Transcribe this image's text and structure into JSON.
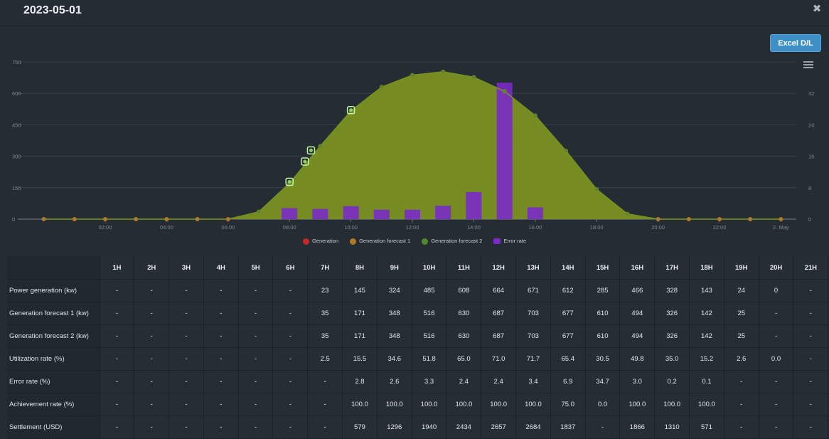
{
  "window": {
    "title": "2023-05-01",
    "close_icon": "close-icon",
    "excel_label": "Excel D/L",
    "menu_icon": "hamburger-menu-icon"
  },
  "colors": {
    "background": "#262c34",
    "forecast_area": "#7d9521",
    "forecast2_line": "#5b8a2c",
    "generation": "#c62828",
    "forecast1": "#b07a2a",
    "forecast2": "#4f8a2b",
    "error_bar": "#7b2ac8",
    "button": "#3d8fc6"
  },
  "chart_data": {
    "type": "area",
    "x_tick_labels": [
      "02:00",
      "04:00",
      "06:00",
      "08:00",
      "10:00",
      "12:00",
      "14:00",
      "16:00",
      "18:00",
      "20:00",
      "22:00",
      "2. May"
    ],
    "x_range_hours": [
      -0.5,
      24.5
    ],
    "y_left_ticks": [
      "0",
      "150",
      "300",
      "450",
      "600",
      "750"
    ],
    "y_left_range": [
      0,
      750
    ],
    "y_right_ticks": [
      "0",
      "8",
      "16",
      "24",
      "32"
    ],
    "y_right_range": [
      0,
      40
    ],
    "grid": true,
    "legend_position": "bottom-center",
    "series": [
      {
        "name": "Generation",
        "kind": "line",
        "axis": "left",
        "x": [
          8,
          8.5,
          8.7,
          10
        ],
        "values": [
          178,
          275,
          328,
          520
        ]
      },
      {
        "name": "Generation forecast 1",
        "kind": "line",
        "axis": "left",
        "x": [
          0,
          1,
          2,
          3,
          4,
          5,
          6,
          7,
          8,
          9,
          10,
          11,
          12,
          13,
          14,
          15,
          16,
          17,
          18,
          19,
          20,
          21,
          22,
          23,
          24
        ],
        "values": [
          0,
          0,
          0,
          0,
          0,
          0,
          0,
          35,
          171,
          348,
          516,
          630,
          687,
          703,
          677,
          610,
          494,
          326,
          142,
          25,
          0,
          0,
          0,
          0,
          0
        ]
      },
      {
        "name": "Generation forecast 2",
        "kind": "area",
        "axis": "left",
        "x": [
          0,
          1,
          2,
          3,
          4,
          5,
          6,
          7,
          8,
          9,
          10,
          11,
          12,
          13,
          14,
          15,
          16,
          17,
          18,
          19,
          20,
          21,
          22,
          23,
          24
        ],
        "values": [
          0,
          0,
          0,
          0,
          0,
          0,
          0,
          35,
          171,
          348,
          516,
          630,
          687,
          703,
          677,
          610,
          494,
          326,
          142,
          25,
          0,
          0,
          0,
          0,
          0
        ]
      },
      {
        "name": "Error rate",
        "kind": "bar",
        "axis": "right",
        "x": [
          8,
          9,
          10,
          11,
          12,
          13,
          14,
          15,
          16
        ],
        "values": [
          2.8,
          2.6,
          3.3,
          2.4,
          2.4,
          3.4,
          6.9,
          34.7,
          3.0
        ]
      }
    ]
  },
  "legend": [
    {
      "label": "Generation",
      "color": "#c62828",
      "shape": "dot"
    },
    {
      "label": "Generation forecast 1",
      "color": "#b07a2a",
      "shape": "dot"
    },
    {
      "label": "Generation forecast 2",
      "color": "#4f8a2b",
      "shape": "dot"
    },
    {
      "label": "Error rate",
      "color": "#7b2ac8",
      "shape": "square"
    }
  ],
  "table": {
    "columns": [
      "",
      "1H",
      "2H",
      "3H",
      "4H",
      "5H",
      "6H",
      "7H",
      "8H",
      "9H",
      "10H",
      "11H",
      "12H",
      "13H",
      "14H",
      "15H",
      "16H",
      "17H",
      "18H",
      "19H",
      "20H",
      "21H"
    ],
    "rows": [
      {
        "label": "Power generation (kw)",
        "cells": [
          "-",
          "-",
          "-",
          "-",
          "-",
          "-",
          "23",
          "145",
          "324",
          "485",
          "608",
          "664",
          "671",
          "612",
          "285",
          "466",
          "328",
          "143",
          "24",
          "0",
          "-"
        ]
      },
      {
        "label": "Generation forecast 1 (kw)",
        "cells": [
          "-",
          "-",
          "-",
          "-",
          "-",
          "-",
          "35",
          "171",
          "348",
          "516",
          "630",
          "687",
          "703",
          "677",
          "610",
          "494",
          "326",
          "142",
          "25",
          "-",
          "-"
        ]
      },
      {
        "label": "Generation forecast 2 (kw)",
        "cells": [
          "-",
          "-",
          "-",
          "-",
          "-",
          "-",
          "35",
          "171",
          "348",
          "516",
          "630",
          "687",
          "703",
          "677",
          "610",
          "494",
          "326",
          "142",
          "25",
          "-",
          "-"
        ]
      },
      {
        "label": "Utilization rate (%)",
        "cells": [
          "-",
          "-",
          "-",
          "-",
          "-",
          "-",
          "2.5",
          "15.5",
          "34.6",
          "51.8",
          "65.0",
          "71.0",
          "71.7",
          "65.4",
          "30.5",
          "49.8",
          "35.0",
          "15.2",
          "2.6",
          "0.0",
          "-"
        ]
      },
      {
        "label": "Error rate (%)",
        "cells": [
          "-",
          "-",
          "-",
          "-",
          "-",
          "-",
          "-",
          "2.8",
          "2.6",
          "3.3",
          "2.4",
          "2.4",
          "3.4",
          "6.9",
          "34.7",
          "3.0",
          "0.2",
          "0.1",
          "-",
          "-",
          "-"
        ]
      },
      {
        "label": "Achievement rate (%)",
        "cells": [
          "-",
          "-",
          "-",
          "-",
          "-",
          "-",
          "-",
          "100.0",
          "100.0",
          "100.0",
          "100.0",
          "100.0",
          "100.0",
          "75.0",
          "0.0",
          "100.0",
          "100.0",
          "100.0",
          "-",
          "-",
          "-"
        ]
      },
      {
        "label": "Settlement (USD)",
        "cells": [
          "-",
          "-",
          "-",
          "-",
          "-",
          "-",
          "-",
          "579",
          "1296",
          "1940",
          "2434",
          "2657",
          "2684",
          "1837",
          "-",
          "1866",
          "1310",
          "571",
          "-",
          "-",
          "-"
        ]
      }
    ]
  }
}
